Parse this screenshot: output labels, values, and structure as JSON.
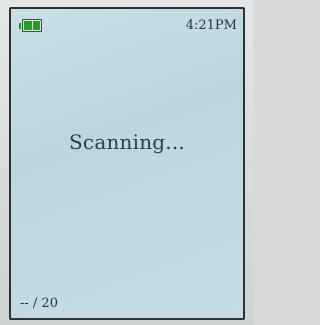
{
  "status_bar": {
    "battery_level": 1.0,
    "battery_color": "#22a022",
    "battery_icon": "battery-icon",
    "time": "4:21PM"
  },
  "main": {
    "message": "Scanning..."
  },
  "footer": {
    "counter": "-- / 20"
  },
  "colors": {
    "screen_background": "#c4dce4",
    "text": "#2f3d46"
  }
}
